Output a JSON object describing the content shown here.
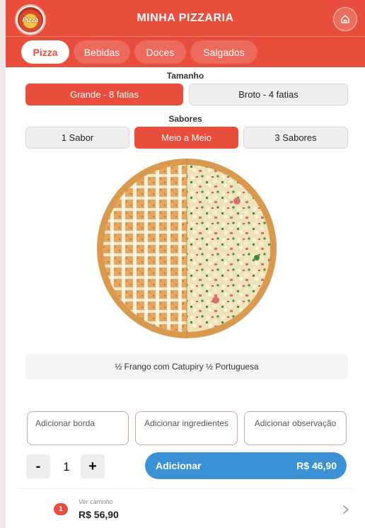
{
  "header": {
    "logo_text": "Pizza",
    "title": "MINHA PIZZARIA"
  },
  "tabs": [
    {
      "label": "Pizza",
      "active": true
    },
    {
      "label": "Bebidas",
      "active": false
    },
    {
      "label": "Doces",
      "active": false
    },
    {
      "label": "Salgados",
      "active": false
    }
  ],
  "size": {
    "label": "Tamanho",
    "options": [
      {
        "label": "Grande - 8 fatias",
        "selected": true
      },
      {
        "label": "Broto - 4 fatias",
        "selected": false
      }
    ]
  },
  "flavors": {
    "label": "Sabores",
    "options": [
      {
        "label": "1 Sabor",
        "selected": false
      },
      {
        "label": "Meio a Meio",
        "selected": true
      },
      {
        "label": "3 Sabores",
        "selected": false
      }
    ]
  },
  "pizza": {
    "left_half": "Frango com Catupiry",
    "right_half": "Portuguesa"
  },
  "description": "½ Frango com Catupiry ½ Portuguesa",
  "options": {
    "border": "Adicionar borda",
    "ingredients": "Adicionar ingredientes",
    "note": "Adicionar observação"
  },
  "quantity": {
    "minus": "-",
    "value": "1",
    "plus": "+"
  },
  "add_button": {
    "label": "Adicionar",
    "price": "R$ 46,90"
  },
  "cart": {
    "count": "1",
    "label": "Ver carrinho",
    "total": "R$ 56,90"
  },
  "colors": {
    "brand": "#e94d3c",
    "action": "#3a91d6"
  }
}
